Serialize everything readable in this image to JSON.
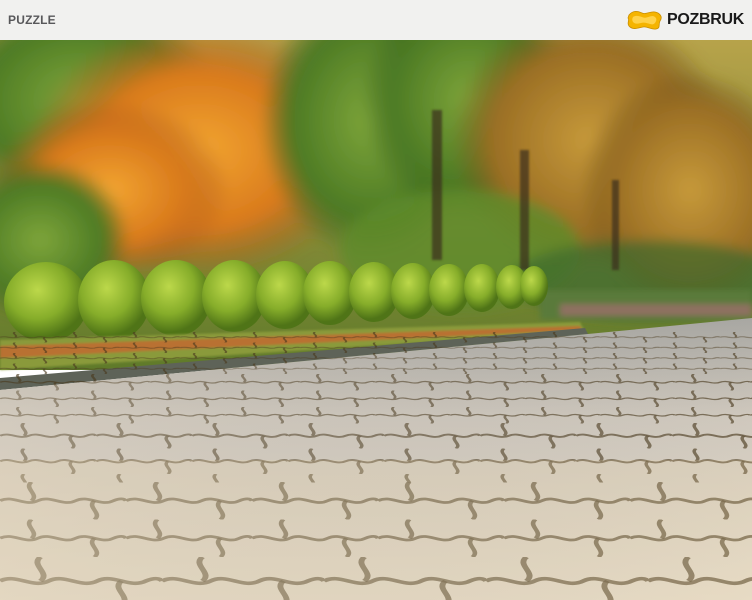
{
  "header": {
    "product_name": "PUZZLE",
    "brand": {
      "name": "POZBRUK",
      "logo_icon": "pozbruk-paver-logo-icon",
      "logo_color": "#f5b400"
    }
  },
  "hero": {
    "image_icon": "paved-park-path-photo"
  }
}
